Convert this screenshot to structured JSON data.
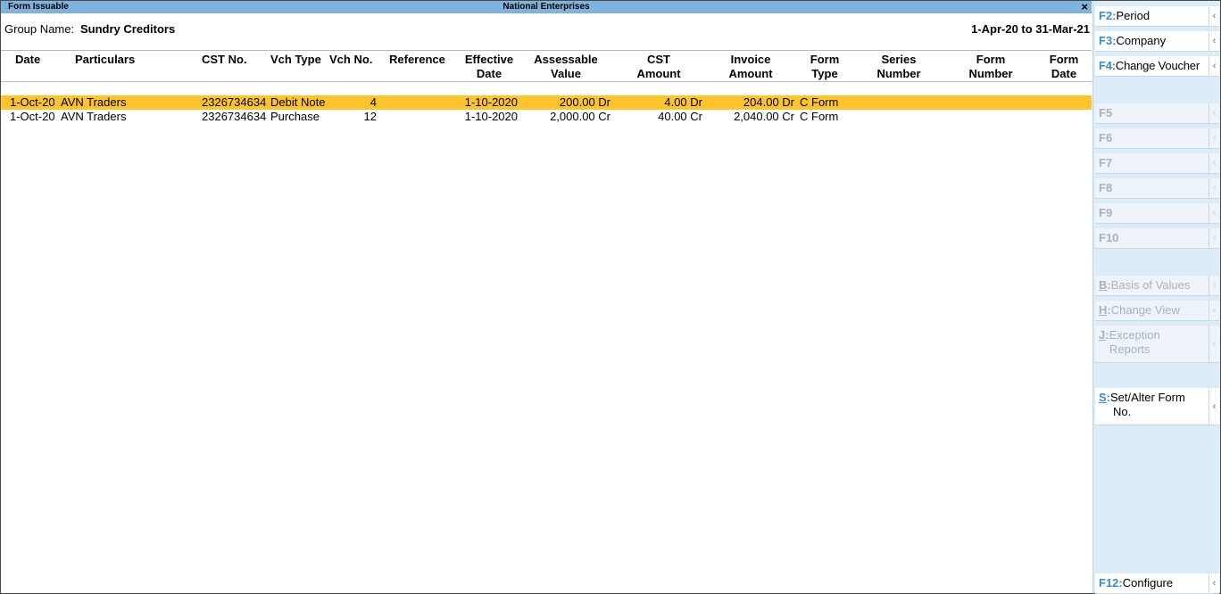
{
  "window": {
    "report_title": "Form Issuable",
    "company_title": "National Enterprises",
    "close_glyph": "×"
  },
  "header": {
    "group_label": "Group Name:",
    "group_value": "Sundry Creditors",
    "period": "1-Apr-20 to 31-Mar-21"
  },
  "columns": {
    "date": "Date",
    "particulars": "Particulars",
    "cst_no": "CST No.",
    "vch_type": "Vch Type",
    "vch_no": "Vch No.",
    "reference": "Reference",
    "effective_date": [
      "Effective",
      "Date"
    ],
    "assessable_value": [
      "Assessable",
      "Value"
    ],
    "cst_amount": [
      "CST",
      "Amount"
    ],
    "invoice_amount": [
      "Invoice",
      "Amount"
    ],
    "form_type": [
      "Form",
      "Type"
    ],
    "series_number": [
      "Series",
      "Number"
    ],
    "form_number": [
      "Form",
      "Number"
    ],
    "form_date": [
      "Form",
      "Date"
    ]
  },
  "rows": [
    {
      "date": "1-Oct-20",
      "particulars": "AVN Traders",
      "cst_no": "2326734634",
      "vch_type": "Debit Note",
      "vch_no": "4",
      "effective_date": "1-10-2020",
      "assessable_value": "200.00 Dr",
      "cst_amount": "4.00 Dr",
      "invoice_amount": "204.00 Dr",
      "form_type": "C Form",
      "selected": true
    },
    {
      "date": "1-Oct-20",
      "particulars": "AVN Traders",
      "cst_no": "2326734634",
      "vch_type": "Purchase",
      "vch_no": "12",
      "effective_date": "1-10-2020",
      "assessable_value": "2,000.00 Cr",
      "cst_amount": "40.00 Cr",
      "invoice_amount": "2,040.00 Cr",
      "form_type": "C Form",
      "selected": false
    }
  ],
  "sidebar": {
    "arrow_glyph": "‹",
    "f2": {
      "key": "F2:",
      "label": "Period"
    },
    "f3": {
      "key": "F3:",
      "label": "Company"
    },
    "f4": {
      "key": "F4:",
      "label": "Change Voucher"
    },
    "f5": {
      "key": "F5"
    },
    "f6": {
      "key": "F6"
    },
    "f7": {
      "key": "F7"
    },
    "f8": {
      "key": "F8"
    },
    "f9": {
      "key": "F9"
    },
    "f10": {
      "key": "F10"
    },
    "b": {
      "key": "B",
      "sep": ":",
      "label": "Basis of Values"
    },
    "h": {
      "key": "H",
      "sep": ":",
      "label": "Change View"
    },
    "j": {
      "key": "J",
      "sep": ":",
      "label1": "Exception",
      "label2": "Reports"
    },
    "s": {
      "key": "S",
      "sep": ":",
      "label1": "Set/Alter Form",
      "label2": "No."
    },
    "f12": {
      "key": "F12:",
      "label": "Configure"
    }
  },
  "colors": {
    "title_bar": "#7fb3de",
    "selected_row": "#fec42e",
    "side_panel": "#dbecf8",
    "key_accent": "#3b8bc9"
  }
}
